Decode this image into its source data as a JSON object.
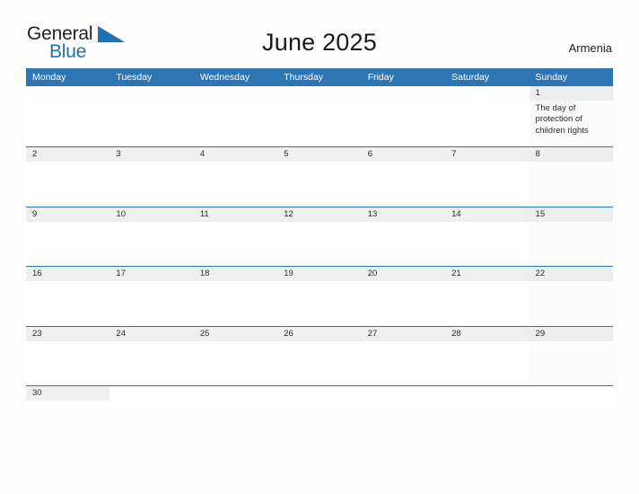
{
  "brand": {
    "word_one": "General",
    "word_two": "Blue",
    "flag_icon": "blue-triangle-flag",
    "color_dark": "#231f20",
    "color_blue": "#2171b5"
  },
  "header": {
    "title": "June 2025",
    "region": "Armenia"
  },
  "theme": {
    "header_blue": "#2e75b6",
    "row_rule_blue": "#2e75b6",
    "date_band_gray": "#efefef",
    "page_background": "#fdfdfd"
  },
  "calendar": {
    "weekdays": [
      "Monday",
      "Tuesday",
      "Wednesday",
      "Thursday",
      "Friday",
      "Saturday",
      "Sunday"
    ],
    "weeks": [
      [
        {
          "date": "",
          "empty": true,
          "events": []
        },
        {
          "date": "",
          "empty": true,
          "events": []
        },
        {
          "date": "",
          "empty": true,
          "events": []
        },
        {
          "date": "",
          "empty": true,
          "events": []
        },
        {
          "date": "",
          "empty": true,
          "events": []
        },
        {
          "date": "",
          "empty": true,
          "events": []
        },
        {
          "date": "1",
          "empty": false,
          "events": [
            "The day of protection of children rights"
          ]
        }
      ],
      [
        {
          "date": "2",
          "empty": false,
          "events": []
        },
        {
          "date": "3",
          "empty": false,
          "events": []
        },
        {
          "date": "4",
          "empty": false,
          "events": []
        },
        {
          "date": "5",
          "empty": false,
          "events": []
        },
        {
          "date": "6",
          "empty": false,
          "events": []
        },
        {
          "date": "7",
          "empty": false,
          "events": []
        },
        {
          "date": "8",
          "empty": false,
          "events": []
        }
      ],
      [
        {
          "date": "9",
          "empty": false,
          "events": []
        },
        {
          "date": "10",
          "empty": false,
          "events": []
        },
        {
          "date": "11",
          "empty": false,
          "events": []
        },
        {
          "date": "12",
          "empty": false,
          "events": []
        },
        {
          "date": "13",
          "empty": false,
          "events": []
        },
        {
          "date": "14",
          "empty": false,
          "events": []
        },
        {
          "date": "15",
          "empty": false,
          "events": []
        }
      ],
      [
        {
          "date": "16",
          "empty": false,
          "events": []
        },
        {
          "date": "17",
          "empty": false,
          "events": []
        },
        {
          "date": "18",
          "empty": false,
          "events": []
        },
        {
          "date": "19",
          "empty": false,
          "events": []
        },
        {
          "date": "20",
          "empty": false,
          "events": []
        },
        {
          "date": "21",
          "empty": false,
          "events": []
        },
        {
          "date": "22",
          "empty": false,
          "events": []
        }
      ],
      [
        {
          "date": "23",
          "empty": false,
          "events": []
        },
        {
          "date": "24",
          "empty": false,
          "events": []
        },
        {
          "date": "25",
          "empty": false,
          "events": []
        },
        {
          "date": "26",
          "empty": false,
          "events": []
        },
        {
          "date": "27",
          "empty": false,
          "events": []
        },
        {
          "date": "28",
          "empty": false,
          "events": []
        },
        {
          "date": "29",
          "empty": false,
          "events": []
        }
      ],
      [
        {
          "date": "30",
          "empty": false,
          "events": []
        },
        {
          "date": "",
          "empty": true,
          "events": []
        },
        {
          "date": "",
          "empty": true,
          "events": []
        },
        {
          "date": "",
          "empty": true,
          "events": []
        },
        {
          "date": "",
          "empty": true,
          "events": []
        },
        {
          "date": "",
          "empty": true,
          "events": []
        },
        {
          "date": "",
          "empty": true,
          "events": []
        }
      ]
    ]
  }
}
